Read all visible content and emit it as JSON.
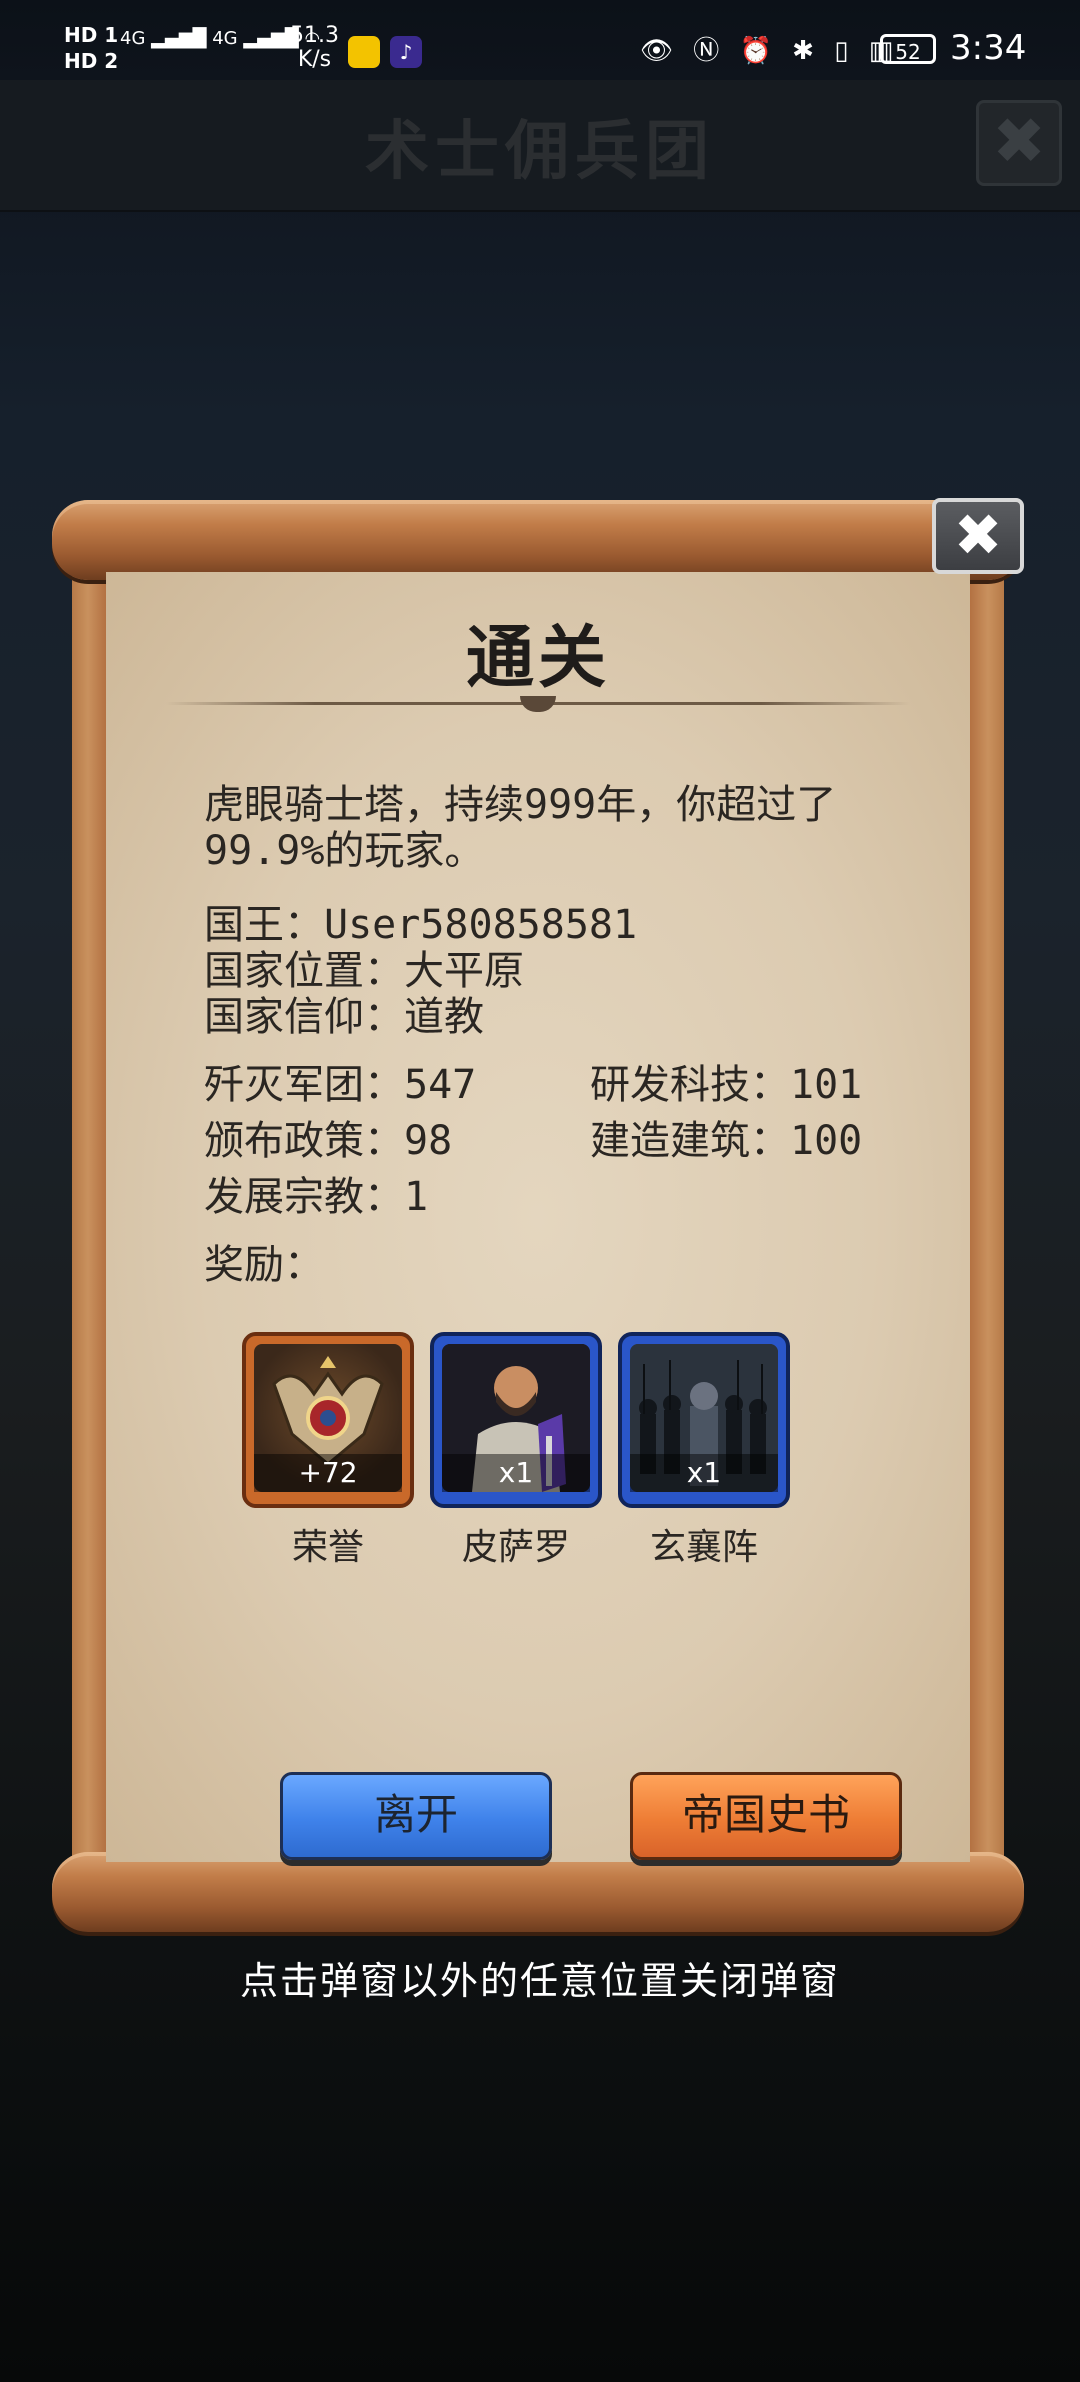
{
  "status_bar": {
    "hd1": "HD 1",
    "hd2": "HD 2",
    "net1": "4G",
    "net2": "4G",
    "speed_value": "51.3",
    "speed_unit": "K/s",
    "battery": "52",
    "time": "3:34"
  },
  "background": {
    "title": "术士佣兵团",
    "close_glyph": "✖"
  },
  "popup": {
    "title": "通关",
    "summary": "虎眼骑士塔，持续999年，你超过了99.9%的玩家。",
    "king_line": "国王：User580858581",
    "location_line": "国家位置：大平原",
    "faith_line": "国家信仰：道教",
    "stats": {
      "legions": "歼灭军团：547",
      "tech": "研发科技：101",
      "policies": "颁布政策：98",
      "buildings": "建造建筑：100",
      "religion": "发展宗教：1"
    },
    "rewards_label": "奖励：",
    "rewards": [
      {
        "name": "荣誉",
        "qty": "+72",
        "icon": "honor-emblem-icon"
      },
      {
        "name": "皮萨罗",
        "qty": "x1",
        "icon": "hero-portrait-icon"
      },
      {
        "name": "玄襄阵",
        "qty": "x1",
        "icon": "army-formation-icon"
      }
    ],
    "buttons": {
      "leave": "离开",
      "history": "帝国史书"
    },
    "close_glyph": "✖"
  },
  "hint": "点击弹窗以外的任意位置关闭弹窗"
}
